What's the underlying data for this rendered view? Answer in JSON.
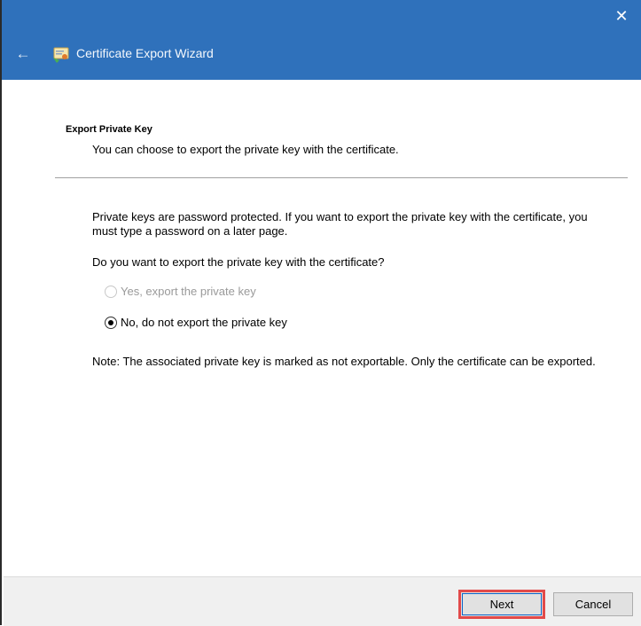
{
  "window": {
    "title": "Certificate Export Wizard",
    "close_label": "✕",
    "back_label": "←",
    "accent_color": "#2f71bb"
  },
  "page": {
    "heading": "Export Private Key",
    "subheading": "You can choose to export the private key with the certificate.",
    "info": "Private keys are password protected. If you want to export the private key with the certificate, you must type a password on a later page.",
    "question": "Do you want to export the private key with the certificate?",
    "options": [
      {
        "label": "Yes, export the private key",
        "selected": false,
        "enabled": false
      },
      {
        "label": "No, do not export the private key",
        "selected": true,
        "enabled": true
      }
    ],
    "note": "Note: The associated private key is marked as not exportable. Only the certificate can be exported."
  },
  "footer": {
    "next_label": "Next",
    "cancel_label": "Cancel",
    "highlight_color": "#e24a4a"
  },
  "icons": {
    "back": "back-arrow-icon",
    "close": "close-icon",
    "wizard": "certificate-wizard-icon"
  }
}
